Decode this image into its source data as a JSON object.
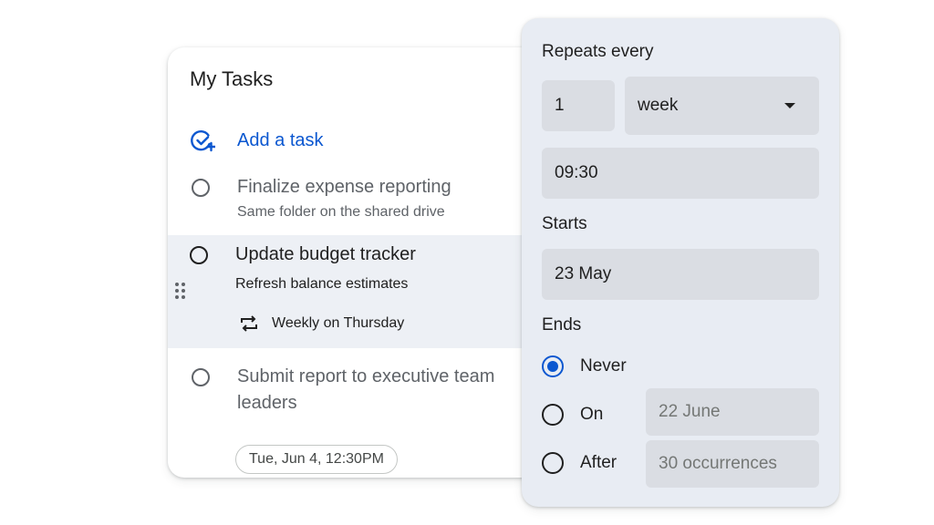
{
  "tasks": {
    "title": "My Tasks",
    "add_task_label": "Add a task",
    "items": [
      {
        "title": "Finalize expense reporting",
        "subtitle": "Same folder on the shared drive"
      },
      {
        "title": "Update budget tracker",
        "subtitle": "Refresh balance estimates",
        "repeat": "Weekly on Thursday"
      },
      {
        "title_line1": "Submit report to executive team",
        "title_line2": "leaders",
        "due_chip": "Tue, Jun 4, 12:30PM"
      }
    ]
  },
  "repeat_panel": {
    "repeats_label": "Repeats every",
    "interval_value": "1",
    "unit_value": "week",
    "time_value": "09:30",
    "starts_label": "Starts",
    "start_date": "23 May",
    "ends_label": "Ends",
    "ends_options": [
      {
        "label": "Never",
        "checked": true
      },
      {
        "label": "On",
        "checked": false,
        "value": "22 June"
      },
      {
        "label": "After",
        "checked": false,
        "value": "30 occurrences"
      }
    ]
  },
  "colors": {
    "accent": "#0b57d0",
    "panel_bg": "#e8ecf3",
    "selected_row_bg": "#edf0f5"
  },
  "icons": [
    "add-task-icon",
    "repeat-icon",
    "drag-handle-icon",
    "dropdown-arrow-icon"
  ]
}
